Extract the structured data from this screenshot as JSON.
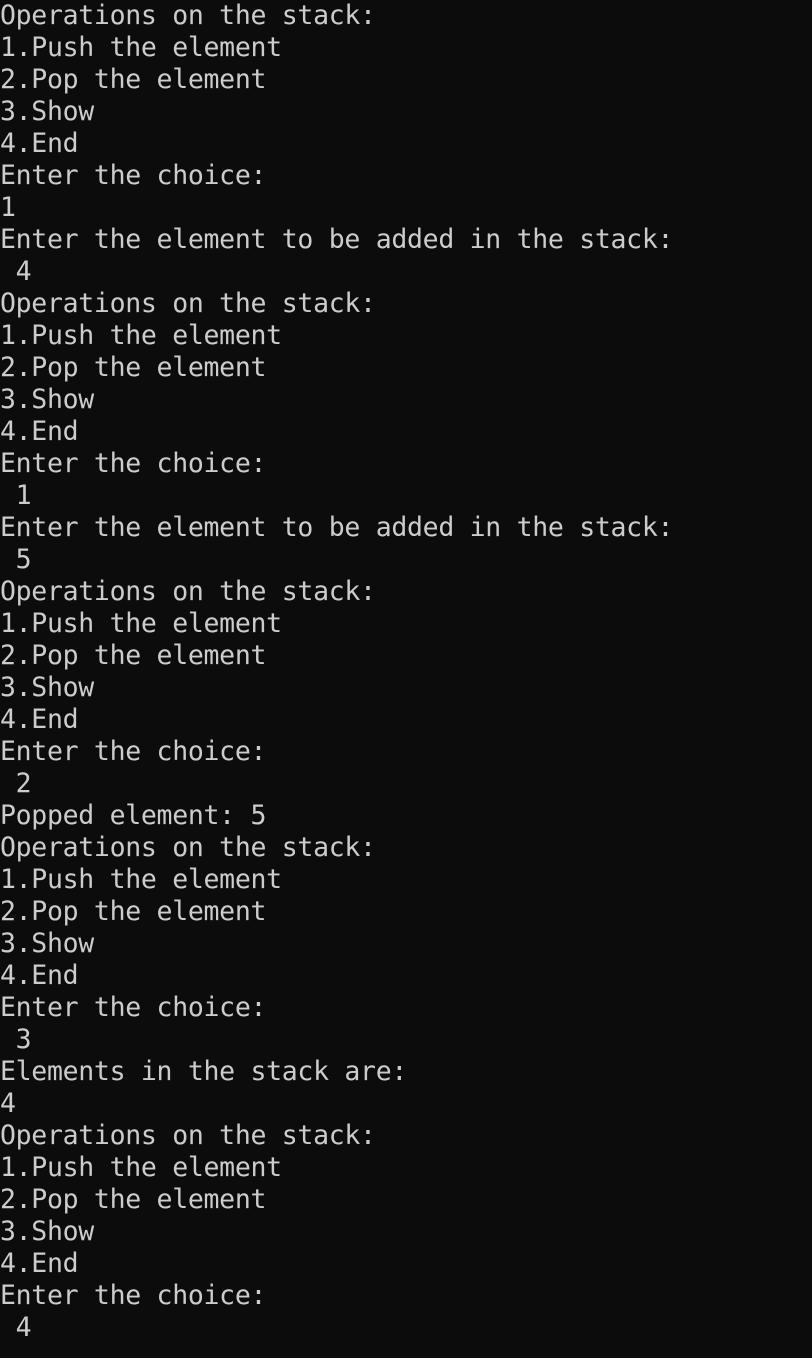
{
  "console": {
    "lines": [
      "Operations on the stack:",
      "1.Push the element",
      "2.Pop the element",
      "3.Show",
      "4.End",
      "Enter the choice:",
      "1",
      "Enter the element to be added in the stack:",
      " 4",
      "Operations on the stack:",
      "1.Push the element",
      "2.Pop the element",
      "3.Show",
      "4.End",
      "Enter the choice:",
      " 1",
      "Enter the element to be added in the stack:",
      " 5",
      "Operations on the stack:",
      "1.Push the element",
      "2.Pop the element",
      "3.Show",
      "4.End",
      "Enter the choice:",
      " 2",
      "Popped element: 5",
      "Operations on the stack:",
      "1.Push the element",
      "2.Pop the element",
      "3.Show",
      "4.End",
      "Enter the choice:",
      " 3",
      "Elements in the stack are:",
      "4",
      "Operations on the stack:",
      "1.Push the element",
      "2.Pop the element",
      "3.Show",
      "4.End",
      "Enter the choice:",
      " 4"
    ]
  }
}
